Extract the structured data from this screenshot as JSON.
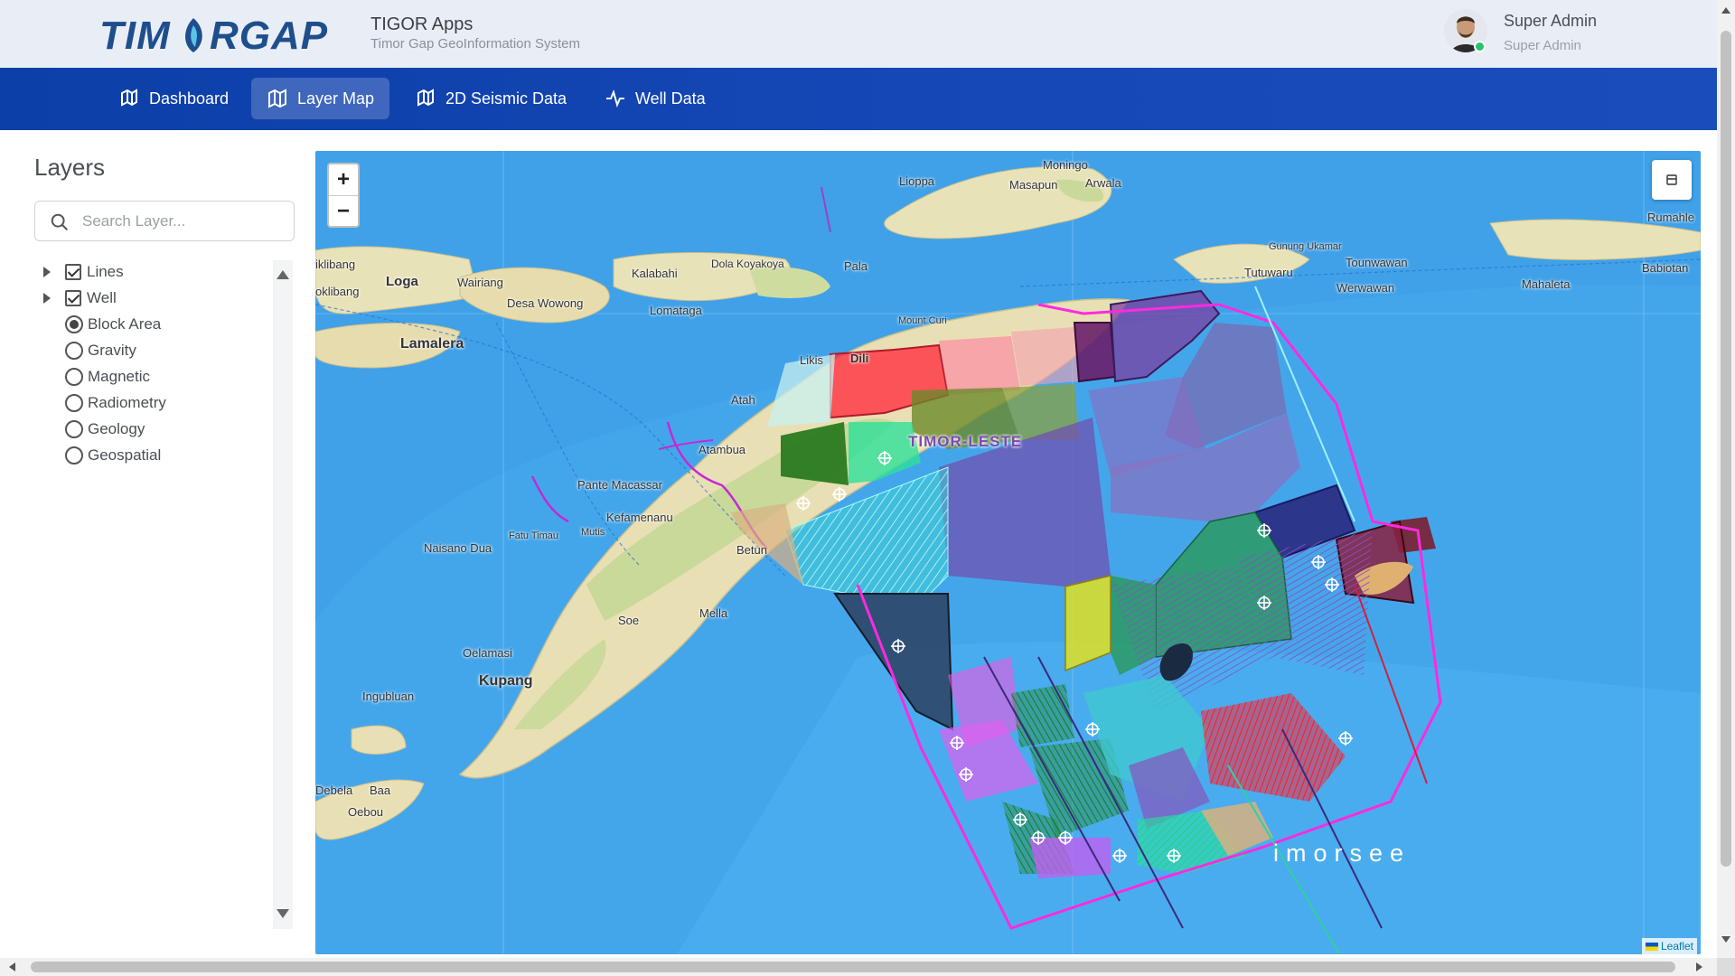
{
  "header": {
    "logo_text": "TIMORGAP",
    "app_title": "TIGOR Apps",
    "app_subtitle": "Timor Gap GeoInformation System",
    "user_name": "Super Admin",
    "user_role": "Super Admin"
  },
  "nav": {
    "items": [
      {
        "label": "Dashboard",
        "icon": "map-book-icon",
        "active": false
      },
      {
        "label": "Layer Map",
        "icon": "folded-map-icon",
        "active": true
      },
      {
        "label": "2D Seismic Data",
        "icon": "map-book-icon",
        "active": false
      },
      {
        "label": "Well Data",
        "icon": "pulse-icon",
        "active": false
      }
    ]
  },
  "sidebar": {
    "title": "Layers",
    "search_placeholder": "Search Layer...",
    "layers": [
      {
        "label": "Lines",
        "control": "checkbox",
        "checked": true,
        "expandable": true
      },
      {
        "label": "Well",
        "control": "checkbox",
        "checked": true,
        "expandable": true
      },
      {
        "label": "Block Area",
        "control": "radio",
        "checked": true
      },
      {
        "label": "Gravity",
        "control": "radio",
        "checked": false
      },
      {
        "label": "Magnetic",
        "control": "radio",
        "checked": false
      },
      {
        "label": "Radiometry",
        "control": "radio",
        "checked": false
      },
      {
        "label": "Geology",
        "control": "radio",
        "checked": false
      },
      {
        "label": "Geospatial",
        "control": "radio",
        "checked": false
      }
    ]
  },
  "map": {
    "zoom_in": "+",
    "zoom_out": "−",
    "attribution": "Leaflet",
    "labels": {
      "moningo": "Moningo",
      "masapun": "Masapun",
      "arwala": "Arwala",
      "lioppa": "Lioppa",
      "rumahle": "Rumahle",
      "babiotan": "Babiotan",
      "gunung": "Gunung Ukamar",
      "tutuwaru": "Tutuwaru",
      "tounwawan": "Tounwawan",
      "werwawan": "Werwawan",
      "mahaleta": "Mahaleta",
      "kalabahi": "Kalabahi",
      "dola": "Dola Koyakoya",
      "pala": "Pala",
      "wairiang": "Wairiang",
      "desa": "Desa Wowong",
      "lomataga": "Lomataga",
      "loga": "Loga",
      "lamalera": "Lamalera",
      "iklibang1": "iklibang",
      "iklibang2": "oklibang",
      "mount": "Mount Curi",
      "dili": "Dili",
      "likis": "Likis",
      "atauro": "Atah",
      "atambua": "Atambua",
      "timorleste": "TIMOR-LESTE",
      "pante": "Pante Macassar",
      "kefamenanu": "Kefamenanu",
      "naisano": "Naisano Dua",
      "fatu": "Fatu Timau",
      "mutis": "Mutis",
      "betun": "Betun",
      "soe": "Soe",
      "mella": "Mella",
      "oelamasi": "Oelamasi",
      "kupang": "Kupang",
      "ingubluan": "Ingubluan",
      "debela": "Debela",
      "baa": "Baa",
      "oebou": "Oebou",
      "timorsee": "imorsee"
    }
  },
  "colors": {
    "nav_bg": "#0d3fa8",
    "sea": "#3aa0e8",
    "land": "#e9dfb4",
    "boundary": "#ff3ad6"
  }
}
